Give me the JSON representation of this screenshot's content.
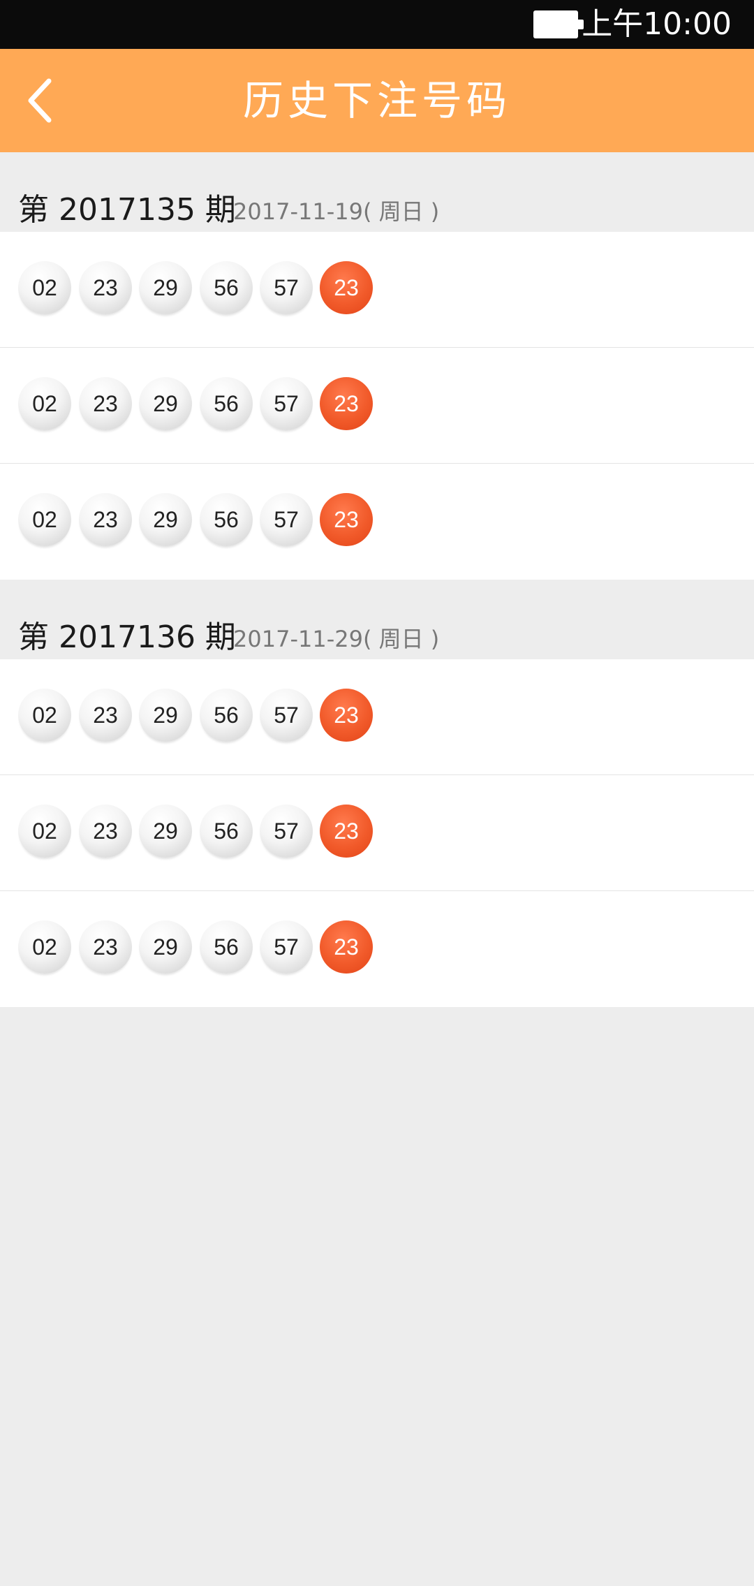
{
  "status_bar": {
    "time": "上午10:00",
    "battery_icon": "battery-full-icon"
  },
  "nav": {
    "title": "历史下注号码",
    "back_icon": "chevron-left-icon",
    "bg_color": "#ffa955"
  },
  "colors": {
    "red_ball": "#f15a2a",
    "white_ball": "#f4f4f4",
    "page_bg": "#ededed"
  },
  "periods": [
    {
      "label": "第 2017135 期",
      "date": "2017-11-19( 周日 )",
      "rows": [
        {
          "white": [
            "02",
            "23",
            "29",
            "56",
            "57"
          ],
          "red": "23"
        },
        {
          "white": [
            "02",
            "23",
            "29",
            "56",
            "57"
          ],
          "red": "23"
        },
        {
          "white": [
            "02",
            "23",
            "29",
            "56",
            "57"
          ],
          "red": "23"
        }
      ]
    },
    {
      "label": "第 2017136 期",
      "date": "2017-11-29( 周日 )",
      "rows": [
        {
          "white": [
            "02",
            "23",
            "29",
            "56",
            "57"
          ],
          "red": "23"
        },
        {
          "white": [
            "02",
            "23",
            "29",
            "56",
            "57"
          ],
          "red": "23"
        },
        {
          "white": [
            "02",
            "23",
            "29",
            "56",
            "57"
          ],
          "red": "23"
        }
      ]
    }
  ]
}
